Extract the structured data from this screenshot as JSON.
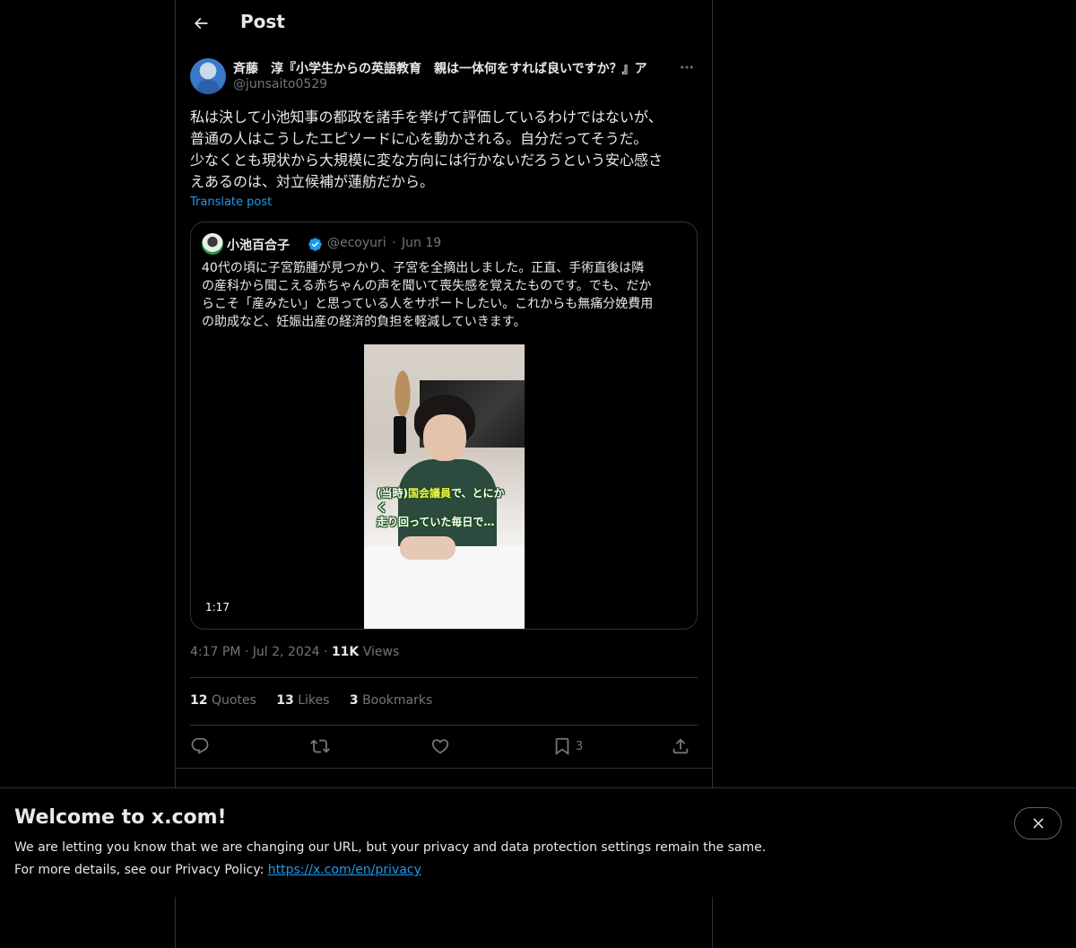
{
  "header": {
    "title": "Post"
  },
  "post": {
    "author_name": "斉藤　淳『小学生からの英語教育　親は一体何をすれば良いですか？』ア",
    "author_handle": "@junsaito0529",
    "text": "私は決して小池知事の都政を諸手を挙げて評価しているわけではないが、\n普通の人はこうしたエピソードに心を動かされる。自分だってそうだ。\n少なくとも現状から大規模に変な方向には行かないだろうという安心感さ\nえあるのは、対立候補が蓮舫だから。",
    "translate_label": "Translate post",
    "time": "4:17 PM",
    "date": "Jul 2, 2024",
    "views_count": "11K",
    "views_label": "Views",
    "dot": "·"
  },
  "quote": {
    "name": "小池百合子",
    "handle": "@ecoyuri",
    "dot": "·",
    "date": "Jun 19",
    "text": "40代の頃に子宮筋腫が見つかり、子宮を全摘出しました。正直、手術直後は隣\nの産科から聞こえる赤ちゃんの声を聞いて喪失感を覚えたものです。でも、だか\nらこそ「産みたい」と思っている人をサポートしたい。これからも無痛分娩費用\nの助成など、妊娠出産の経済的負担を軽減していきます。",
    "video_caption_prefix": "(当時)",
    "video_caption_highlight": "国会議員",
    "video_caption_rest": "で、とにかく",
    "video_caption_line2": "走り回っていた毎日で…",
    "duration": "1:17"
  },
  "stats": {
    "quotes_count": "12",
    "quotes_label": "Quotes",
    "likes_count": "13",
    "likes_label": "Likes",
    "bookmarks_count": "3",
    "bookmarks_label": "Bookmarks"
  },
  "actions": {
    "bookmark_count": "3"
  },
  "banner": {
    "title": "Welcome to x.com!",
    "line1": "We are letting you know that we are changing our URL, but your privacy and data protection settings remain the same.",
    "line2_prefix": "For more details, see our Privacy Policy: ",
    "link": "https://x.com/en/privacy"
  },
  "colors": {
    "background": "#000000",
    "text_primary": "#e7e9ea",
    "text_secondary": "#71767b",
    "accent": "#1d9bf0",
    "border": "#2f3336"
  },
  "icons": [
    "arrow-left-icon",
    "more-icon",
    "verified-icon",
    "reply-icon",
    "repost-icon",
    "like-icon",
    "bookmark-icon",
    "share-icon",
    "close-icon"
  ]
}
